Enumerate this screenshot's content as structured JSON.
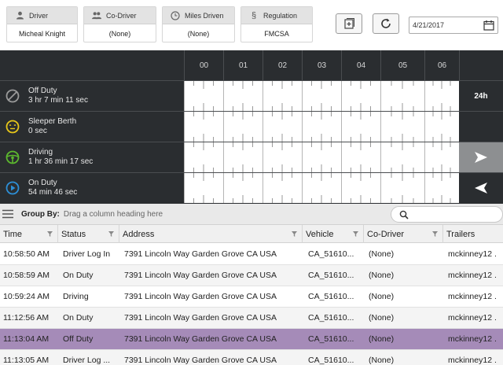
{
  "header": {
    "cards": [
      {
        "id": "driver",
        "label": "Driver",
        "value": "Micheal Knight",
        "icon": "person-icon"
      },
      {
        "id": "co_driver",
        "label": "Co-Driver",
        "value": "(None)",
        "icon": "people-icon"
      },
      {
        "id": "miles",
        "label": "Miles Driven",
        "value": "(None)",
        "icon": "clock-icon"
      },
      {
        "id": "regulation",
        "label": "Regulation",
        "value": "FMCSA",
        "icon": "section-icon"
      }
    ],
    "date": "4/21/2017"
  },
  "grid": {
    "hours": [
      "00",
      "01",
      "02",
      "03",
      "04",
      "05",
      "06"
    ],
    "statuses": [
      {
        "name": "Off Duty",
        "duration": "3 hr 7 min 11 sec",
        "icon": "off-duty-icon",
        "color": "#9a9a9a"
      },
      {
        "name": "Sleeper Berth",
        "duration": "0 sec",
        "icon": "sleeper-icon",
        "color": "#e6c619"
      },
      {
        "name": "Driving",
        "duration": "1 hr 36 min 17 sec",
        "icon": "steering-wheel-icon",
        "color": "#5cb82e"
      },
      {
        "name": "On Duty",
        "duration": "54 min 46 sec",
        "icon": "play-icon",
        "color": "#2d8fd6"
      }
    ],
    "range_label": "24h"
  },
  "groupbar": {
    "label": "Group By:",
    "hint": "Drag a column heading here"
  },
  "table": {
    "columns": [
      "Time",
      "Status",
      "Address",
      "Vehicle",
      "Co-Driver",
      "Trailers"
    ],
    "rows": [
      [
        "10:58:50 AM",
        "Driver Log In",
        "7391 Lincoln Way Garden Grove CA USA",
        "CA_51610...",
        "(None)",
        "mckinney12 ."
      ],
      [
        "10:58:59 AM",
        "On Duty",
        "7391 Lincoln Way Garden Grove CA USA",
        "CA_51610...",
        "(None)",
        "mckinney12 ."
      ],
      [
        "10:59:24 AM",
        "Driving",
        "7391 Lincoln Way Garden Grove CA USA",
        "CA_51610...",
        "(None)",
        "mckinney12 ."
      ],
      [
        "11:12:56 AM",
        "On Duty",
        "7391 Lincoln Way Garden Grove CA USA",
        "CA_51610...",
        "(None)",
        "mckinney12 ."
      ],
      [
        "11:13:04 AM",
        "Off Duty",
        "7391 Lincoln Way Garden Grove CA USA",
        "CA_51610...",
        "(None)",
        "mckinney12 ."
      ],
      [
        "11:13:05 AM",
        "Driver Log ...",
        "7391 Lincoln Way Garden Grove CA USA",
        "CA_51610...",
        "(None)",
        "mckinney12 ."
      ]
    ],
    "selected_row": 4
  },
  "colors": {
    "grid_bg": "#2a2d30",
    "selected_row": "#a58bb8"
  }
}
